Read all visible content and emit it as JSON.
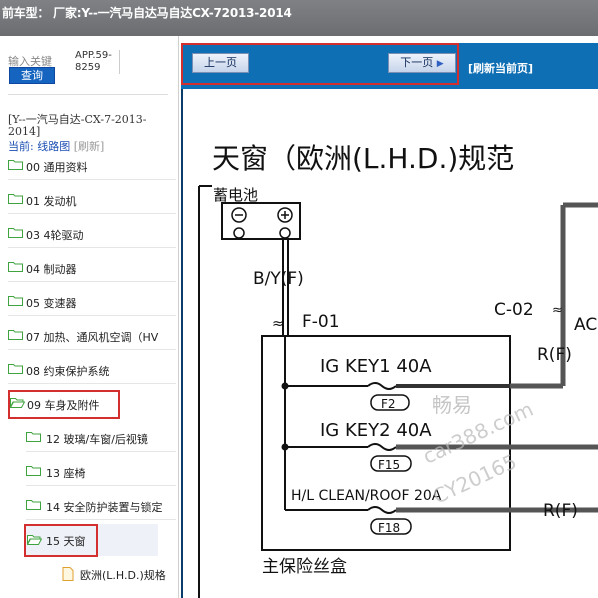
{
  "title_bar": {
    "text": "前车型：   厂家:Y--一汽马自达马自达CX-72013-2014"
  },
  "search": {
    "label": "输入关键",
    "button": "查询",
    "app_code": "APP.59-8259"
  },
  "sidebar": {
    "model_text": "[Y--一汽马自达-CX-7-2013-2014]",
    "current_label": "当前:",
    "current_link": "线路图",
    "refresh": "[刷新]",
    "items": [
      {
        "label": "00 通用资料"
      },
      {
        "label": "01 发动机"
      },
      {
        "label": "03 4轮驱动"
      },
      {
        "label": "04 制动器"
      },
      {
        "label": "05 变速器"
      },
      {
        "label": "07 加热、通风机空调（HV"
      },
      {
        "label": "08 约束保护系统"
      },
      {
        "label": "09 车身及附件"
      },
      {
        "label": "12 玻璃/车窗/后视镜"
      },
      {
        "label": "13 座椅"
      },
      {
        "label": "14 安全防护装置与锁定"
      },
      {
        "label": "15 天窗"
      },
      {
        "label": "欧洲(L.H.D.)规格"
      }
    ]
  },
  "toolbar": {
    "prev": "上一页",
    "next": "下一页",
    "refresh_current": "[刷新当前页]"
  },
  "diagram": {
    "title": "天窗（欧洲(L.H.D.)规范",
    "battery_label": "蓄电池",
    "wire_b_y": "B/Y(F)",
    "connector_f01": "F-01",
    "connector_c02": "C-02",
    "connector_ac": "AC",
    "wire_r_f_1": "R(F)",
    "wire_r_f_2": "R(F)",
    "fuse1_name": "IG KEY1 40A",
    "fuse1_id": "F2",
    "fuse2_name": "IG KEY2 40A",
    "fuse2_id": "F15",
    "fuse3_name": "H/L CLEAN/ROOF 20A",
    "fuse3_id": "F18",
    "fuse_box_label": "主保险丝盒",
    "watermark1": "畅易",
    "watermark2": "car388.com",
    "watermark3": "CY20165"
  },
  "colors": {
    "toolbar": "#0f6fb5",
    "highlight": "#d32f2f",
    "title_bar": "#777a7d"
  }
}
